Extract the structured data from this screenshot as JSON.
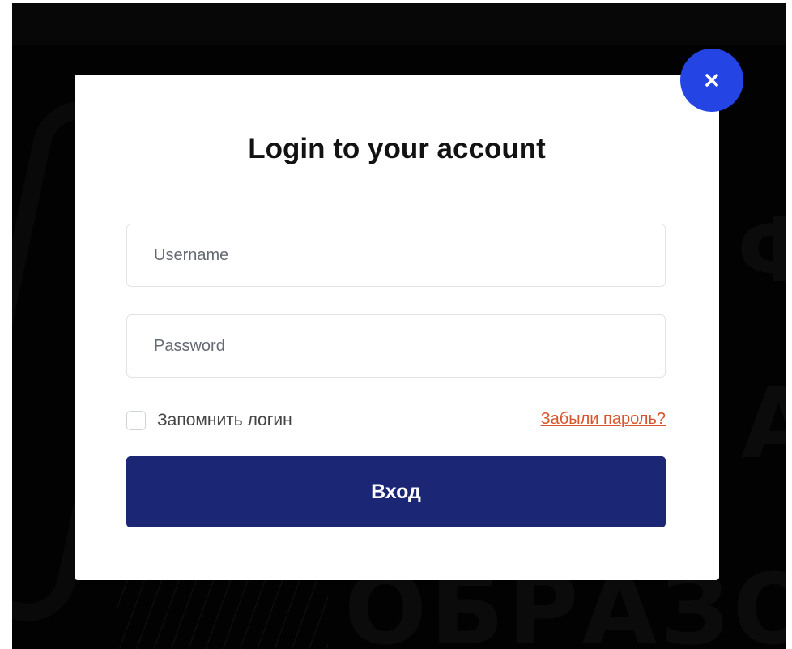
{
  "modal": {
    "title": "Login to your account",
    "close_icon": "close-icon",
    "username_placeholder": "Username",
    "password_placeholder": "Password",
    "remember_label": "Запомнить логин",
    "remember_checked": false,
    "forgot_link": "Забыли пароль?",
    "submit_label": "Вход"
  },
  "background": {
    "letters": [
      "Ф",
      "А"
    ],
    "word": "ОБРАЗО"
  },
  "colors": {
    "close_button": "#2444e4",
    "submit_button": "#1b2775",
    "forgot_link": "#d9542b",
    "overlay": "#020202"
  }
}
